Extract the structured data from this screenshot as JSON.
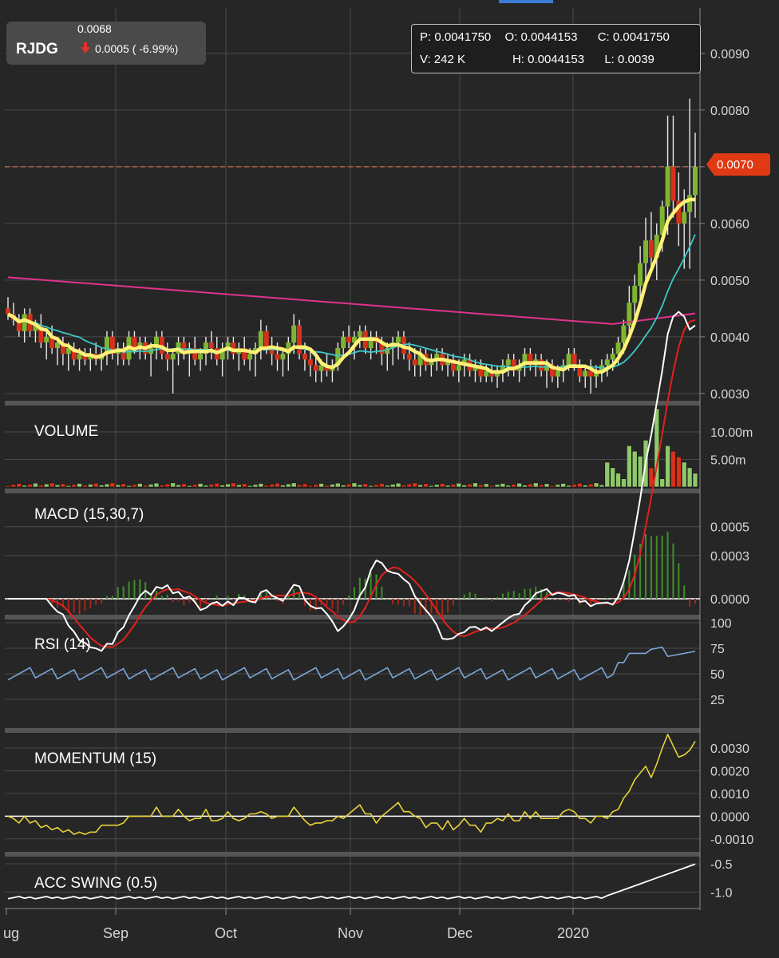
{
  "ticker": {
    "symbol": "RJDG",
    "last": "0.0068",
    "change": "0.0005 ( -6.99%)",
    "direction": "down"
  },
  "ohlc": {
    "p_label": "P:",
    "p_value": "0.0041750",
    "o_label": "O:",
    "o_value": "0.0044153",
    "c_label": "C:",
    "c_value": "0.0041750",
    "v_label": "V:",
    "v_value": "242 K",
    "h_label": "H:",
    "h_value": "0.0044153",
    "l_label": "L:",
    "l_value": "0.0039"
  },
  "price_tag": "0.0070",
  "colors": {
    "background": "#262626",
    "grid": "#4a4a4a",
    "up": "#7fb531",
    "down": "#d6321b",
    "sma_yellow": "#fff176",
    "sma_cyan": "#3ec7c7",
    "sma_magenta": "#e0338c",
    "rsi": "#7ba7d8",
    "momentum": "#e7d23a",
    "price_tag": "#e03a14"
  },
  "chart_data": [
    {
      "type": "candlestick",
      "name": "price",
      "yticks": [
        "0.0090",
        "0.0080",
        "0.0070",
        "0.0060",
        "0.0050",
        "0.0040",
        "0.0030"
      ],
      "ylim": [
        0.0029,
        0.0098
      ],
      "x_labels": [
        "ug",
        "Sep",
        "Oct",
        "Nov",
        "Dec",
        "2020"
      ],
      "candles": [
        [
          0.0045,
          0.0047,
          0.0043,
          0.0044
        ],
        [
          0.0044,
          0.0046,
          0.0042,
          0.0043
        ],
        [
          0.0043,
          0.0044,
          0.004,
          0.0041
        ],
        [
          0.0041,
          0.0045,
          0.0039,
          0.0044
        ],
        [
          0.0044,
          0.0045,
          0.004,
          0.0041
        ],
        [
          0.0041,
          0.0043,
          0.0039,
          0.0042
        ],
        [
          0.0042,
          0.0044,
          0.0038,
          0.0039
        ],
        [
          0.0039,
          0.0041,
          0.0036,
          0.004
        ],
        [
          0.004,
          0.0042,
          0.0037,
          0.0038
        ],
        [
          0.0038,
          0.004,
          0.0035,
          0.0039
        ],
        [
          0.0039,
          0.004,
          0.0035,
          0.0037
        ],
        [
          0.0037,
          0.0039,
          0.0034,
          0.0038
        ],
        [
          0.0038,
          0.0039,
          0.0035,
          0.0036
        ],
        [
          0.0036,
          0.0038,
          0.0034,
          0.0037
        ],
        [
          0.0037,
          0.0038,
          0.0035,
          0.0036
        ],
        [
          0.0036,
          0.0038,
          0.0034,
          0.0037
        ],
        [
          0.0037,
          0.0039,
          0.0035,
          0.0036
        ],
        [
          0.0036,
          0.0038,
          0.0034,
          0.0037
        ],
        [
          0.0037,
          0.0041,
          0.0035,
          0.004
        ],
        [
          0.004,
          0.0041,
          0.0036,
          0.0037
        ],
        [
          0.0037,
          0.0039,
          0.0035,
          0.0038
        ],
        [
          0.0038,
          0.0039,
          0.0035,
          0.0036
        ],
        [
          0.0036,
          0.0041,
          0.0035,
          0.004
        ],
        [
          0.004,
          0.0041,
          0.0037,
          0.0038
        ],
        [
          0.0038,
          0.004,
          0.0036,
          0.0039
        ],
        [
          0.0039,
          0.004,
          0.0036,
          0.0037
        ],
        [
          0.0037,
          0.0039,
          0.0033,
          0.0038
        ],
        [
          0.0038,
          0.0041,
          0.0036,
          0.004
        ],
        [
          0.004,
          0.0041,
          0.0036,
          0.0037
        ],
        [
          0.0037,
          0.0039,
          0.0034,
          0.0036
        ],
        [
          0.0036,
          0.0038,
          0.003,
          0.0037
        ],
        [
          0.0037,
          0.004,
          0.0035,
          0.0039
        ],
        [
          0.0039,
          0.004,
          0.0036,
          0.0037
        ],
        [
          0.0037,
          0.0039,
          0.0033,
          0.0038
        ],
        [
          0.0038,
          0.004,
          0.0035,
          0.0036
        ],
        [
          0.0036,
          0.0038,
          0.0034,
          0.0037
        ],
        [
          0.0037,
          0.004,
          0.0035,
          0.0039
        ],
        [
          0.0039,
          0.0041,
          0.0036,
          0.0038
        ],
        [
          0.0038,
          0.004,
          0.0035,
          0.0036
        ],
        [
          0.0036,
          0.0039,
          0.0033,
          0.0038
        ],
        [
          0.0038,
          0.004,
          0.0036,
          0.0039
        ],
        [
          0.0039,
          0.004,
          0.0036,
          0.0037
        ],
        [
          0.0037,
          0.0039,
          0.0034,
          0.0038
        ],
        [
          0.0038,
          0.004,
          0.0035,
          0.0036
        ],
        [
          0.0036,
          0.0038,
          0.0034,
          0.0037
        ],
        [
          0.0037,
          0.0039,
          0.0033,
          0.0038
        ],
        [
          0.0038,
          0.0043,
          0.0036,
          0.0041
        ],
        [
          0.0041,
          0.0042,
          0.0037,
          0.0038
        ],
        [
          0.0038,
          0.004,
          0.0035,
          0.0037
        ],
        [
          0.0037,
          0.0039,
          0.0034,
          0.0036
        ],
        [
          0.0036,
          0.0038,
          0.0033,
          0.0037
        ],
        [
          0.0037,
          0.004,
          0.0034,
          0.0039
        ],
        [
          0.0039,
          0.0044,
          0.0037,
          0.0042
        ],
        [
          0.0042,
          0.0043,
          0.0036,
          0.0037
        ],
        [
          0.0037,
          0.0039,
          0.0034,
          0.0036
        ],
        [
          0.0036,
          0.0038,
          0.0033,
          0.0035
        ],
        [
          0.0035,
          0.0037,
          0.0032,
          0.0034
        ],
        [
          0.0034,
          0.0036,
          0.0032,
          0.0035
        ],
        [
          0.0035,
          0.0037,
          0.0033,
          0.0034
        ],
        [
          0.0034,
          0.0036,
          0.0032,
          0.0035
        ],
        [
          0.0035,
          0.0039,
          0.0034,
          0.0038
        ],
        [
          0.0038,
          0.0041,
          0.0036,
          0.004
        ],
        [
          0.004,
          0.0042,
          0.0038,
          0.0039
        ],
        [
          0.0039,
          0.0041,
          0.0036,
          0.004
        ],
        [
          0.004,
          0.0042,
          0.0038,
          0.0041
        ],
        [
          0.0041,
          0.0042,
          0.0037,
          0.0038
        ],
        [
          0.0038,
          0.0041,
          0.0036,
          0.004
        ],
        [
          0.004,
          0.0041,
          0.0037,
          0.0039
        ],
        [
          0.0039,
          0.004,
          0.0035,
          0.0037
        ],
        [
          0.0037,
          0.0039,
          0.0034,
          0.0038
        ],
        [
          0.0038,
          0.004,
          0.0035,
          0.0039
        ],
        [
          0.0039,
          0.0041,
          0.0036,
          0.004
        ],
        [
          0.004,
          0.0041,
          0.0036,
          0.0037
        ],
        [
          0.0037,
          0.0039,
          0.0034,
          0.0036
        ],
        [
          0.0036,
          0.0038,
          0.0033,
          0.0035
        ],
        [
          0.0035,
          0.0038,
          0.0033,
          0.0037
        ],
        [
          0.0037,
          0.0038,
          0.0034,
          0.0035
        ],
        [
          0.0035,
          0.0037,
          0.0033,
          0.0036
        ],
        [
          0.0036,
          0.0038,
          0.0034,
          0.0037
        ],
        [
          0.0037,
          0.0038,
          0.0034,
          0.0035
        ],
        [
          0.0035,
          0.0037,
          0.0033,
          0.0036
        ],
        [
          0.0036,
          0.0037,
          0.0033,
          0.0034
        ],
        [
          0.0034,
          0.0036,
          0.0032,
          0.0035
        ],
        [
          0.0035,
          0.0037,
          0.0033,
          0.0036
        ],
        [
          0.0036,
          0.0037,
          0.0033,
          0.0034
        ],
        [
          0.0034,
          0.0036,
          0.0032,
          0.0035
        ],
        [
          0.0035,
          0.0036,
          0.0032,
          0.0033
        ],
        [
          0.0033,
          0.0035,
          0.0032,
          0.0034
        ],
        [
          0.0034,
          0.0035,
          0.0032,
          0.0033
        ],
        [
          0.0033,
          0.0035,
          0.0031,
          0.0034
        ],
        [
          0.0034,
          0.0036,
          0.0032,
          0.0035
        ],
        [
          0.0035,
          0.0037,
          0.0033,
          0.0036
        ],
        [
          0.0036,
          0.0037,
          0.0033,
          0.0034
        ],
        [
          0.0034,
          0.0036,
          0.0032,
          0.0035
        ],
        [
          0.0035,
          0.0038,
          0.0033,
          0.0037
        ],
        [
          0.0037,
          0.0038,
          0.0034,
          0.0035
        ],
        [
          0.0035,
          0.0037,
          0.0033,
          0.0036
        ],
        [
          0.0036,
          0.0037,
          0.0033,
          0.0034
        ],
        [
          0.0034,
          0.0036,
          0.0031,
          0.0035
        ],
        [
          0.0035,
          0.0036,
          0.0032,
          0.0033
        ],
        [
          0.0033,
          0.0035,
          0.0031,
          0.0034
        ],
        [
          0.0034,
          0.0036,
          0.0032,
          0.0035
        ],
        [
          0.0035,
          0.0038,
          0.0034,
          0.0037
        ],
        [
          0.0037,
          0.0038,
          0.0034,
          0.0035
        ],
        [
          0.0035,
          0.0036,
          0.0032,
          0.0033
        ],
        [
          0.0033,
          0.0035,
          0.0031,
          0.0034
        ],
        [
          0.0034,
          0.0036,
          0.003,
          0.0033
        ],
        [
          0.0033,
          0.0035,
          0.0031,
          0.0034
        ],
        [
          0.0034,
          0.0036,
          0.0032,
          0.0035
        ],
        [
          0.0035,
          0.0037,
          0.0033,
          0.0036
        ],
        [
          0.0036,
          0.0038,
          0.0034,
          0.0037
        ],
        [
          0.0037,
          0.004,
          0.0035,
          0.0039
        ],
        [
          0.0039,
          0.0043,
          0.0037,
          0.0042
        ],
        [
          0.0042,
          0.0049,
          0.004,
          0.0046
        ],
        [
          0.0046,
          0.0051,
          0.0043,
          0.0049
        ],
        [
          0.0049,
          0.0056,
          0.0046,
          0.0053
        ],
        [
          0.0053,
          0.0061,
          0.0049,
          0.0057
        ],
        [
          0.0057,
          0.0062,
          0.0052,
          0.0054
        ],
        [
          0.0054,
          0.006,
          0.005,
          0.0058
        ],
        [
          0.0058,
          0.0064,
          0.0055,
          0.0063
        ],
        [
          0.0063,
          0.0079,
          0.0058,
          0.007
        ],
        [
          0.007,
          0.0079,
          0.0061,
          0.0064
        ],
        [
          0.0064,
          0.0069,
          0.0056,
          0.006
        ],
        [
          0.006,
          0.0066,
          0.0052,
          0.0062
        ],
        [
          0.0062,
          0.0082,
          0.0052,
          0.0065
        ],
        [
          0.0065,
          0.0076,
          0.0061,
          0.007
        ]
      ],
      "overlays": [
        "sma-yellow",
        "sma-cyan",
        "sma-magenta"
      ]
    },
    {
      "type": "bar",
      "name": "volume",
      "label": "VOLUME",
      "yticks": [
        "10.00m",
        "5.00m"
      ]
    },
    {
      "type": "line",
      "name": "macd",
      "label": "MACD (15,30,7)",
      "yticks": [
        "0.0005",
        "0.0003",
        "0.0000"
      ]
    },
    {
      "type": "line",
      "name": "rsi",
      "label": "RSI (14)",
      "yticks": [
        "100",
        "75",
        "50",
        "25"
      ]
    },
    {
      "type": "line",
      "name": "momentum",
      "label": "MOMENTUM (15)",
      "yticks": [
        "0.0030",
        "0.0020",
        "0.0010",
        "0.0000",
        "-0.0010"
      ]
    },
    {
      "type": "line",
      "name": "acc-swing",
      "label": "ACC SWING (0.5)",
      "yticks": [
        "-0.5",
        "-1.0"
      ]
    }
  ]
}
